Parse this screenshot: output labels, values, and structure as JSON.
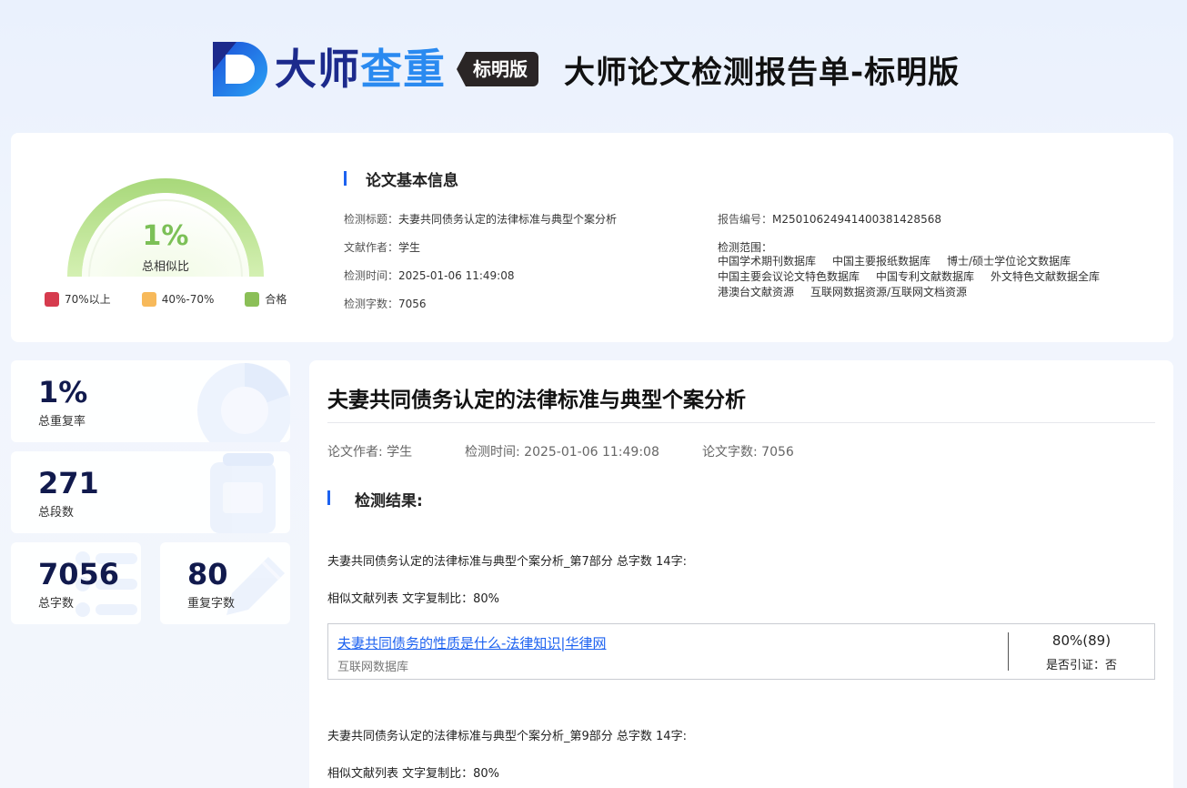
{
  "header": {
    "logo_part1": "大师",
    "logo_part2": "查重",
    "badge": "标明版",
    "report_title": "大师论文检测报告单-标明版"
  },
  "summary": {
    "similarity_value": "1%",
    "similarity_fraction": 0.01,
    "similarity_label": "总相似比",
    "legend": [
      {
        "label": "70%以上",
        "color": "#d63b4e"
      },
      {
        "label": "40%-70%",
        "color": "#f7b95a"
      },
      {
        "label": "合格",
        "color": "#8bbf57"
      }
    ],
    "info_title": "论文基本信息",
    "left_fields": [
      {
        "k": "检测标题：",
        "v": "夫妻共同债务认定的法律标准与典型个案分析"
      },
      {
        "k": "文献作者：",
        "v": "学生"
      },
      {
        "k": "检测时间：",
        "v": "2025-01-06 11:49:08"
      },
      {
        "k": "检测字数：",
        "v": "7056"
      }
    ],
    "report_no_label": "报告编号：",
    "report_no": "M25010624941400381428568",
    "scope_label": "检测范围：",
    "scope_lines": [
      [
        "中国学术期刊数据库",
        "中国主要报纸数据库",
        "博士/硕士学位论文数据库"
      ],
      [
        "中国主要会议论文特色数据库",
        "中国专利文献数据库",
        "外文特色文献数据全库"
      ],
      [
        "港澳台文献资源",
        "互联网数据资源/互联网文档资源"
      ]
    ]
  },
  "stats": {
    "overall_rate": {
      "value": "1%",
      "label": "总重复率"
    },
    "paragraphs": {
      "value": "271",
      "label": "总段数"
    },
    "total_chars": {
      "value": "7056",
      "label": "总字数"
    },
    "dup_chars": {
      "value": "80",
      "label": "重复字数"
    }
  },
  "report": {
    "title": "夫妻共同债务认定的法律标准与典型个案分析",
    "author": "论文作者: 学生",
    "time": "检测时间: 2025-01-06 11:49:08",
    "chars": "论文字数: 7056",
    "result_title": "检测结果:",
    "section1": "夫妻共同债务认定的法律标准与典型个案分析_第7部分 总字数 14字:",
    "similar1": "相似文献列表 文字复制比：80%",
    "match": {
      "link": "夫妻共同债务的性质是什么-法律知识|华律网",
      "source": "互联网数据库",
      "percent": "80%(89)",
      "cited": "是否引证：否"
    },
    "section2": "夫妻共同债务认定的法律标准与典型个案分析_第9部分 总字数 14字:",
    "similar2": "相似文献列表 文字复制比：80%"
  },
  "colors": {
    "accent": "#1d62f0",
    "gauge_green": "#7cc057",
    "navy": "#111a4d"
  }
}
